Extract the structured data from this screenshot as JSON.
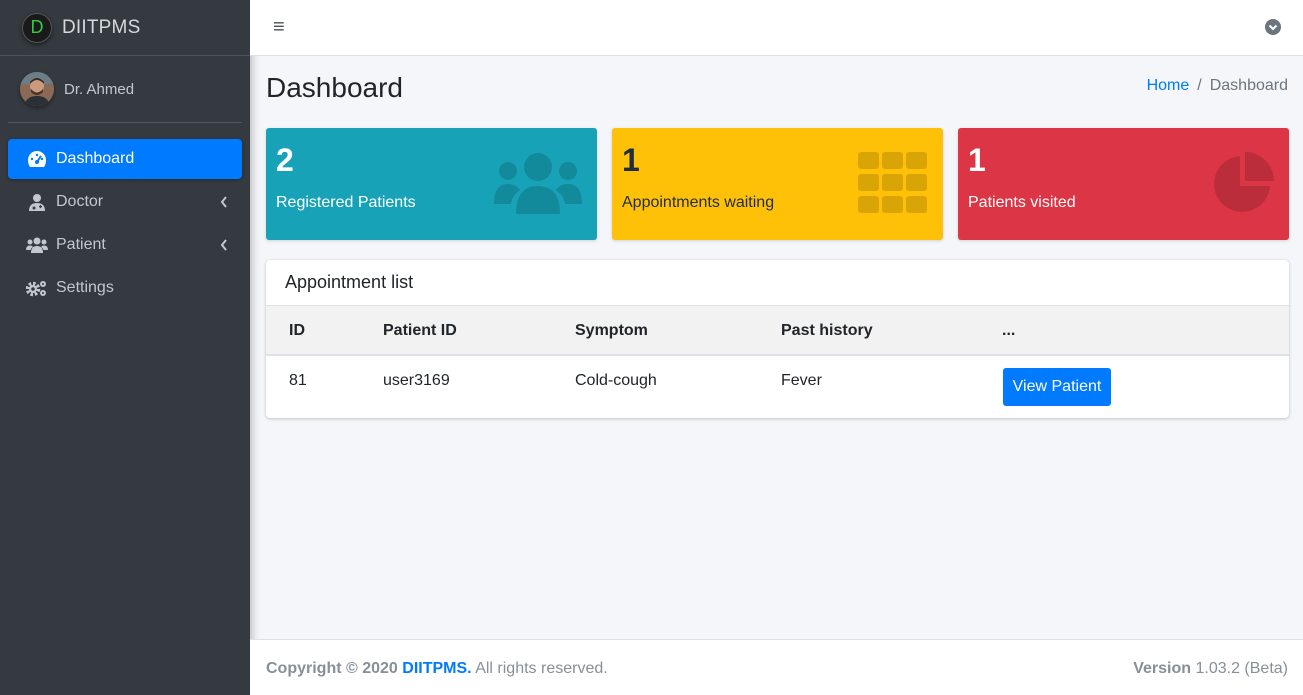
{
  "app": {
    "brand_letter": "D",
    "brand_name": "DIITPMS"
  },
  "user": {
    "name": "Dr. Ahmed"
  },
  "sidebar": {
    "items": [
      {
        "label": "Dashboard",
        "icon": "tachometer-icon",
        "active": true
      },
      {
        "label": "Doctor",
        "icon": "user-md-icon",
        "has_submenu": true
      },
      {
        "label": "Patient",
        "icon": "users-icon",
        "has_submenu": true
      },
      {
        "label": "Settings",
        "icon": "cogs-icon"
      }
    ]
  },
  "topbar": {
    "menu_glyph": "≡"
  },
  "header": {
    "title": "Dashboard"
  },
  "breadcrumb": {
    "home": "Home",
    "separator": "/",
    "current": "Dashboard"
  },
  "stats": [
    {
      "value": "2",
      "label": "Registered Patients",
      "color": "#17a2b8",
      "icon": "users-icon"
    },
    {
      "value": "1",
      "label": "Appointments waiting",
      "color": "#ffc107",
      "icon": "th-grid-icon"
    },
    {
      "value": "1",
      "label": "Patients visited",
      "color": "#dc3545",
      "icon": "pie-chart-icon"
    }
  ],
  "appointments": {
    "title": "Appointment list",
    "columns": [
      "ID",
      "Patient ID",
      "Symptom",
      "Past history",
      "..."
    ],
    "rows": [
      {
        "id": "81",
        "patient_id": "user3169",
        "symptom": "Cold-cough",
        "past_history": "Fever",
        "action": "View Patient"
      }
    ]
  },
  "footer": {
    "copyright_prefix": "Copyright © 2020",
    "brand_link": "DIITPMS.",
    "suffix": "All rights reserved.",
    "version_label": "Version",
    "version_value": "1.03.2 (Beta)"
  },
  "colors": {
    "primary": "#007bff",
    "sidebar_bg": "#343a40",
    "info": "#17a2b8",
    "warning": "#ffc107",
    "danger": "#dc3545"
  }
}
